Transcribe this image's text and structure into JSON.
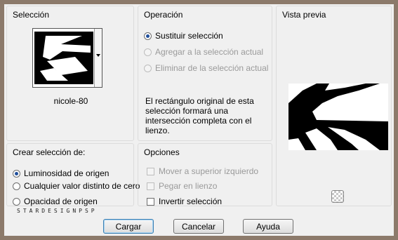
{
  "seleccion": {
    "title": "Selección",
    "thumbnail_name": "nicole-80"
  },
  "operacion": {
    "title": "Operación",
    "options": [
      {
        "label": "Sustituir selección",
        "selected": true,
        "enabled": true
      },
      {
        "label": "Agregar a la selección actual",
        "selected": false,
        "enabled": false
      },
      {
        "label": "Eliminar de la selección actual",
        "selected": false,
        "enabled": false
      }
    ],
    "description": "El rectángulo original de esta selección formará una intersección completa con el lienzo."
  },
  "vista_previa": {
    "title": "Vista previa"
  },
  "crear": {
    "title": "Crear selección de:",
    "options": [
      {
        "label": "Luminosidad de origen",
        "selected": true
      },
      {
        "label": "Cualquier valor distinto de cero",
        "selected": false
      },
      {
        "label": "Opacidad de origen",
        "selected": false
      }
    ]
  },
  "opciones": {
    "title": "Opciones",
    "options": [
      {
        "label": "Mover a superior izquierdo",
        "checked": false,
        "enabled": false
      },
      {
        "label": "Pegar en lienzo",
        "checked": false,
        "enabled": false
      },
      {
        "label": "Invertir selección",
        "checked": false,
        "enabled": true
      }
    ]
  },
  "watermark": "STARDESIGNPSP",
  "buttons": {
    "cargar": "Cargar",
    "cancelar": "Cancelar",
    "ayuda": "Ayuda"
  },
  "colors": {
    "frame": "#8c7a6b",
    "dialog_bg": "#f0f0f0",
    "radio_dot": "#1f4e9b"
  },
  "icons": [
    "dropdown-arrow-icon",
    "transparency-checker-icon"
  ]
}
